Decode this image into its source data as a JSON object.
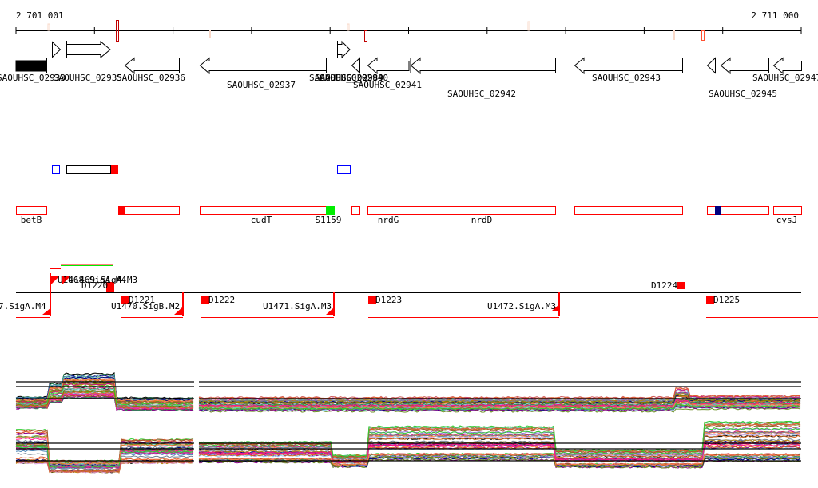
{
  "ruler": {
    "start_label": "2 701 001",
    "end_label": "2 711 000"
  },
  "genes": [
    {
      "id": "g1",
      "label": "SAOUHSC_02933"
    },
    {
      "id": "g2",
      "label": "SAOUHSC_02935"
    },
    {
      "id": "g3",
      "label": "SAOUHSC_02936"
    },
    {
      "id": "g4",
      "label": "SAOUHSC_02937"
    },
    {
      "id": "g5",
      "label": "SAOUHSC_02938"
    },
    {
      "id": "g6",
      "label": "SAOUHSC_02939"
    },
    {
      "id": "g7",
      "label": "SAOUHSC_02940"
    },
    {
      "id": "g8",
      "label": "SAOUHSC_02941"
    },
    {
      "id": "g9",
      "label": "SAOUHSC_02942"
    },
    {
      "id": "g10",
      "label": "SAOUHSC_02943"
    },
    {
      "id": "g11",
      "label": "SAOUHSC_02945"
    },
    {
      "id": "g12",
      "label": "SAOUHSC_02947"
    }
  ],
  "features": {
    "betB": "betB",
    "cudT": "cudT",
    "S1159": "S1159",
    "nrdG": "nrdG",
    "nrdD": "nrdD",
    "cysJ": "cysJ"
  },
  "sites": {
    "u1467": "7.SigA.M4",
    "u1468": "U1468.SigA.M4",
    "u1469": "U1469.SigA.M3",
    "d1220": "D1220",
    "d1221": "D1221",
    "u1470": "U1470.SigB.M2",
    "d1222": "D1222",
    "u1471": "U1471.SigA.M3",
    "d1223": "D1223",
    "u1472": "U1472.SigA.M3",
    "d1224": "D1224",
    "d1225": "D1225"
  },
  "colors": {
    "feature": "#ff0000",
    "expressed": "#00ee00",
    "marker": "#0000ff",
    "dark_marker": "#000080",
    "axis": "#000000"
  }
}
